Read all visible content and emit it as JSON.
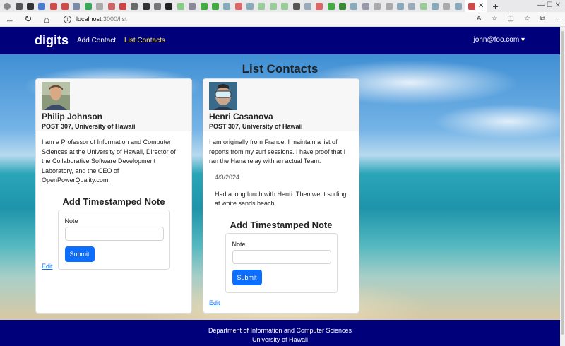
{
  "browser": {
    "url_host": "localhost",
    "url_path": ":3000/list",
    "back_icon": "←",
    "refresh_icon": "↻",
    "home_icon": "⌂",
    "info_icon": "i",
    "tab_close": "✕",
    "new_tab": "+",
    "window_controls": "—  ☐  ✕",
    "toolbar_icons": [
      "A",
      "☆",
      "◫",
      "☆",
      "⧉",
      "…"
    ]
  },
  "app": {
    "brand": "digits",
    "nav": [
      {
        "label": "Add Contact"
      },
      {
        "label": "List Contacts"
      }
    ],
    "user": "john@foo.com ▾"
  },
  "page": {
    "title": "List Contacts"
  },
  "contacts": [
    {
      "name": "Philip Johnson",
      "address": "POST 307, University of Hawaii",
      "description": "I am a Professor of Information and Computer Sciences at the University of Hawaii, Director of the Collaborative Software Development Laboratory, and the CEO of OpenPowerQuality.com.",
      "notes": [],
      "edit_label": "Edit"
    },
    {
      "name": "Henri Casanova",
      "address": "POST 307, University of Hawaii",
      "description": "I am originally from France. I maintain a list of reports from my surf sessions. I have proof that I ran the Hana relay with an actual Team.",
      "notes": [
        {
          "date": "4/3/2024",
          "text": "Had a long lunch with Henri. Then went surfing at white sands beach."
        }
      ],
      "edit_label": "Edit"
    }
  ],
  "note_form": {
    "heading": "Add Timestamped Note",
    "label": "Note",
    "input_value": "",
    "submit_label": "Submit"
  },
  "footer": {
    "line1": "Department of Information and Computer Sciences",
    "line2": "University of Hawaii"
  },
  "colors": {
    "navbar": "#00007a",
    "active_link": "#ffeb3b",
    "primary_button": "#0d6efd"
  }
}
